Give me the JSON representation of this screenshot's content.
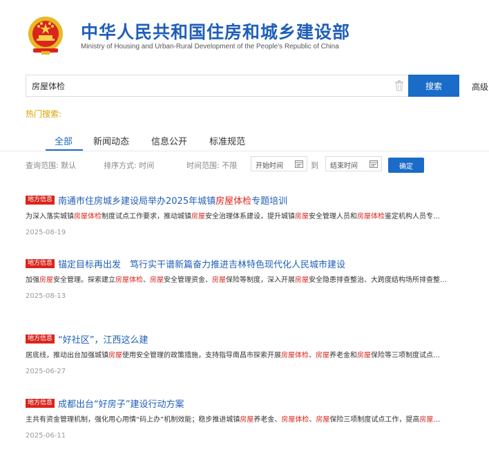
{
  "header": {
    "title_cn": "中华人民共和国住房和城乡建设部",
    "title_en": "Ministry of Housing and Urban-Rural Development of the People's Republic of China"
  },
  "search": {
    "value": "房屋体检",
    "button_label": "搜索",
    "advanced_label": "高级"
  },
  "hot_search_label": "热门搜索:",
  "tabs": [
    "全部",
    "新闻动态",
    "信息公开",
    "标准规范"
  ],
  "filters": {
    "scope_label": "查询范围: 默认",
    "sort_label": "排序方式: 时间",
    "time_label": "时间范围: 不限",
    "start_placeholder": "开始时间",
    "to_label": "到",
    "end_placeholder": "结束时间",
    "confirm_label": "确定"
  },
  "results": [
    {
      "badge": "地方信息",
      "title": [
        {
          "t": "南通市住房城乡建设局举办2025年城镇",
          "h": false
        },
        {
          "t": "房屋体检",
          "h": true
        },
        {
          "t": "专题培训",
          "h": false
        }
      ],
      "snippet": [
        {
          "t": "为深入落实城镇",
          "h": false
        },
        {
          "t": "房屋体检",
          "h": true
        },
        {
          "t": "制度试点工作要求，推动城镇",
          "h": false
        },
        {
          "t": "房屋",
          "h": true
        },
        {
          "t": "安全治理体系建设，提升城镇",
          "h": false
        },
        {
          "t": "房屋",
          "h": true
        },
        {
          "t": "安全管理人员和",
          "h": false
        },
        {
          "t": "房屋体检",
          "h": true
        },
        {
          "t": "鉴定机构人员专…",
          "h": false
        }
      ],
      "date": "2025-08-19"
    },
    {
      "badge": "地方信息",
      "title": [
        {
          "t": "锚定目标再出发　笃行实干谱新篇奋力推进吉林特色现代化人民城市建设",
          "h": false
        }
      ],
      "snippet": [
        {
          "t": "加强",
          "h": false
        },
        {
          "t": "房屋",
          "h": true
        },
        {
          "t": "安全管理。探索建立",
          "h": false
        },
        {
          "t": "房屋体检",
          "h": true
        },
        {
          "t": "、",
          "h": false
        },
        {
          "t": "房屋",
          "h": true
        },
        {
          "t": "安全管理资金、",
          "h": false
        },
        {
          "t": "房屋",
          "h": true
        },
        {
          "t": "保险等制度，深入开展",
          "h": false
        },
        {
          "t": "房屋",
          "h": true
        },
        {
          "t": "安全隐患排查整治、大跨度结构场所排查整…",
          "h": false
        }
      ],
      "date": "2025-08-13"
    },
    {
      "badge": "地方信息",
      "title": [
        {
          "t": "“好社区”，江西这么建",
          "h": false
        }
      ],
      "snippet": [
        {
          "t": "居底线，推动出台加强城镇",
          "h": false
        },
        {
          "t": "房屋",
          "h": true
        },
        {
          "t": "使用安全管理的政策措施，支持指导南昌市探索开展",
          "h": false
        },
        {
          "t": "房屋体检",
          "h": true
        },
        {
          "t": "、",
          "h": false
        },
        {
          "t": "房屋",
          "h": true
        },
        {
          "t": "养老金和",
          "h": false
        },
        {
          "t": "房屋",
          "h": true
        },
        {
          "t": "保险等三项制度试点…",
          "h": false
        }
      ],
      "date": "2025-06-27"
    },
    {
      "badge": "地方信息",
      "title": [
        {
          "t": "成都出台“好房子”建设行动方案",
          "h": false
        }
      ],
      "snippet": [
        {
          "t": "主共有资金管理机制，强化用心用情“码上办”机制效能；稳步推进城镇",
          "h": false
        },
        {
          "t": "房屋",
          "h": true
        },
        {
          "t": "养老金、",
          "h": false
        },
        {
          "t": "房屋体检",
          "h": true
        },
        {
          "t": "、",
          "h": false
        },
        {
          "t": "房屋",
          "h": true
        },
        {
          "t": "保险三项制度试点工作，提高",
          "h": false
        },
        {
          "t": "房屋",
          "h": true
        },
        {
          "t": "…",
          "h": false
        }
      ],
      "date": "2025-06-11"
    }
  ]
}
